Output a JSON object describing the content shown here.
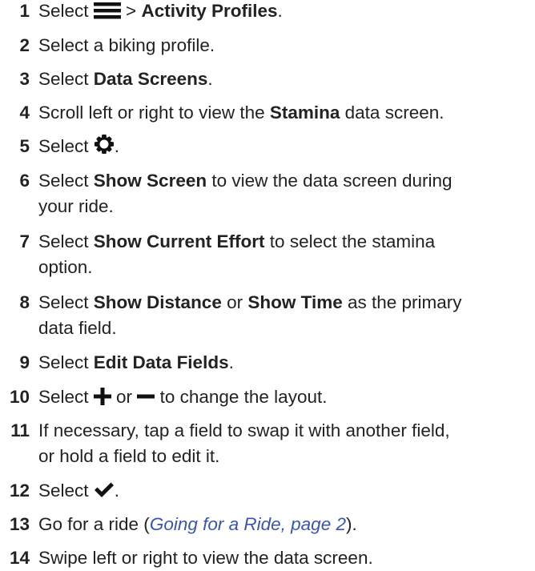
{
  "steps": [
    {
      "num": "1",
      "p": [
        "Select ",
        " > "
      ],
      "b": [
        "Activity Profiles"
      ],
      "end": ".",
      "icon": "menu-icon"
    },
    {
      "num": "2",
      "p": [
        "Select a biking profile."
      ]
    },
    {
      "num": "3",
      "p": [
        "Select "
      ],
      "b": [
        "Data Screens"
      ],
      "end": "."
    },
    {
      "num": "4",
      "p": [
        "Scroll left or right to view the "
      ],
      "b": [
        "Stamina"
      ],
      "end": " data screen."
    },
    {
      "num": "5",
      "p": [
        "Select "
      ],
      "end": ".",
      "icon": "gear-icon"
    },
    {
      "num": "6",
      "p": [
        "Select "
      ],
      "b": [
        "Show Screen"
      ],
      "end": " to view the data screen during",
      "end2": "your ride."
    },
    {
      "num": "7",
      "p": [
        "Select "
      ],
      "b": [
        "Show Current Effort"
      ],
      "end": " to select the stamina",
      "end2": "option."
    },
    {
      "num": "8",
      "p": [
        "Select ",
        " or "
      ],
      "b": [
        "Show Distance",
        "Show Time"
      ],
      "end": " as the primary",
      "end2": "data field."
    },
    {
      "num": "9",
      "p": [
        "Select "
      ],
      "b": [
        "Edit Data Fields"
      ],
      "end": "."
    },
    {
      "num": "10",
      "p": [
        "Select ",
        " or ",
        " to change the layout."
      ],
      "icons": [
        "plus-icon",
        "minus-icon"
      ]
    },
    {
      "num": "11",
      "p": [
        "If necessary, tap a field to swap it with another field,",
        "or hold a field to edit it."
      ]
    },
    {
      "num": "12",
      "p": [
        "Select "
      ],
      "end": ".",
      "icon": "checkmark-icon"
    },
    {
      "num": "13",
      "p": [
        "Go for a ride ("
      ],
      "link": "Going for a Ride, page 2",
      "end": ")."
    },
    {
      "num": "14",
      "p": [
        "Swipe left or right to view the data screen."
      ]
    }
  ]
}
